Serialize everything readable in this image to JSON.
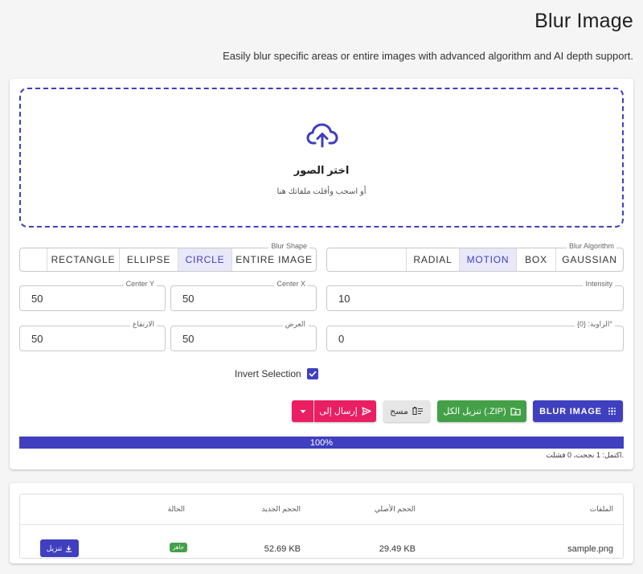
{
  "header": {
    "title": "Blur Image",
    "subtitle": "Easily blur specific areas or entire images with advanced algorithm and AI depth support."
  },
  "dropzone": {
    "icon": "cloud-upload-icon",
    "title": "اختر الصور",
    "subtitle": "أو اسحب وأفلت ملفاتك هنا"
  },
  "algorithm": {
    "legend": "Blur Algorithm",
    "options": [
      "GAUSSIAN",
      "BOX",
      "MOTION",
      "RADIAL"
    ],
    "selected": "MOTION"
  },
  "shape": {
    "legend": "Blur Shape",
    "options": [
      "ENTIRE IMAGE",
      "CIRCLE",
      "ELLIPSE",
      "RECTANGLE"
    ],
    "selected": "CIRCLE"
  },
  "fields": {
    "intensity": {
      "label": "Intensity",
      "value": "10"
    },
    "center_x": {
      "label": "Center X",
      "value": "50"
    },
    "center_y": {
      "label": "Center Y",
      "value": "50"
    },
    "angle": {
      "label": "الزاوية: {0}°",
      "value": "0"
    },
    "width": {
      "label": "العرض",
      "value": "50"
    },
    "height": {
      "label": "الارتفاع",
      "value": "50"
    }
  },
  "invert": {
    "label": "Invert Selection",
    "checked": true
  },
  "actions": {
    "blur": "BLUR IMAGE",
    "zip": "تنزيل الكل (.ZIP)",
    "clear": "مسح",
    "send": "إرسال إلى"
  },
  "progress": {
    "value": 100,
    "label": "100%",
    "status": "اكتمل: 1 نجحت، 0 فشلت."
  },
  "table": {
    "headers": {
      "files": "الملفات",
      "original": "الحجم الأصلي",
      "new": "الحجم الجديد",
      "status": "الحالة"
    },
    "rows": [
      {
        "file": "sample.png",
        "original": "29.49 KB",
        "new": "52.69 KB",
        "status": "جاهز",
        "download": "تنزيل"
      }
    ]
  },
  "colors": {
    "primary": "#3f3fbf",
    "success": "#43a047",
    "accent": "#e91e63"
  }
}
